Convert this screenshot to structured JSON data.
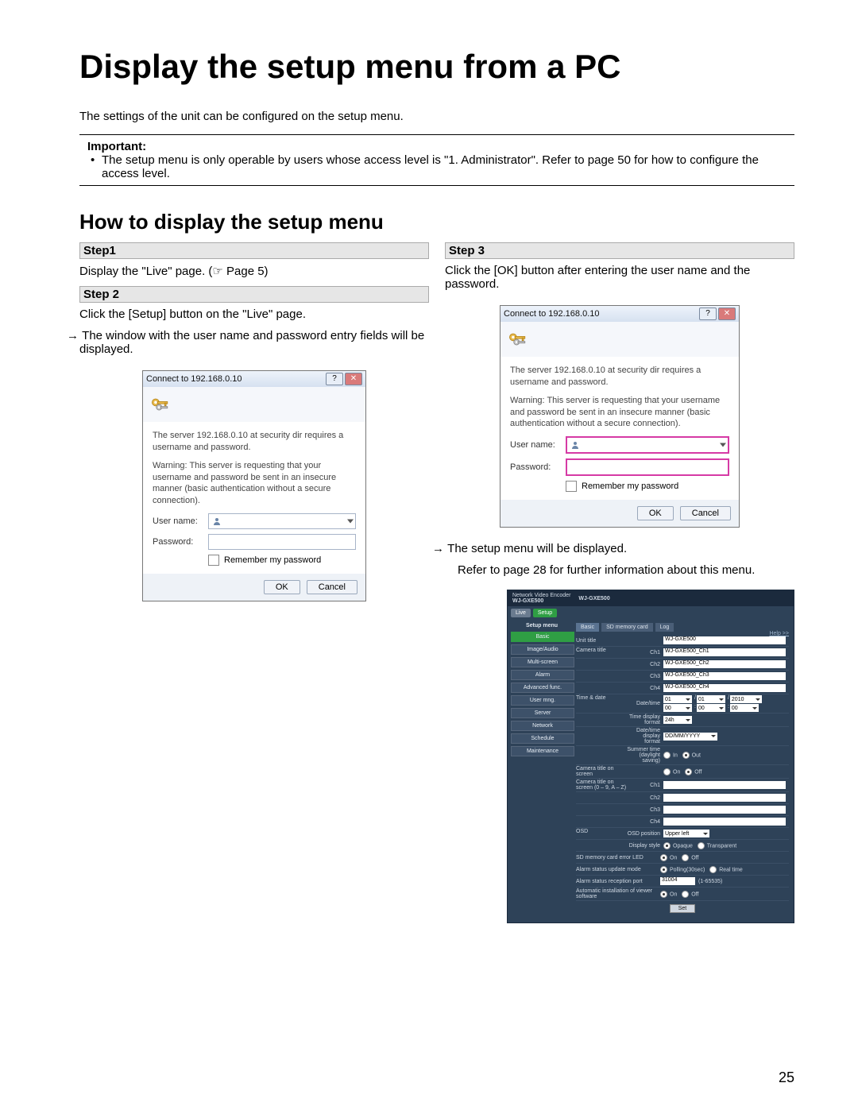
{
  "title": "Display the setup menu from a PC",
  "intro": "The settings of the unit can be configured on the setup menu.",
  "important_label": "Important:",
  "important_body": "The setup menu is only operable by users whose access level is \"1. Administrator\". Refer to page 50 for how to configure the access level.",
  "section_heading": "How to display the setup menu",
  "page_number": "25",
  "left": {
    "step1_label": "Step1",
    "step1_body": "Display the \"Live\" page. (☞ Page 5)",
    "step2_label": "Step 2",
    "step2_body": "Click the [Setup] button on the \"Live\" page.",
    "step2_arrow": "The window with the user name and password entry fields will be displayed."
  },
  "right": {
    "step3_label": "Step 3",
    "step3_body": "Click the [OK] button after entering the user name and the password.",
    "step3_arrow": "The setup menu will be displayed.",
    "step3_ref": "Refer to  page 28 for further information about this menu."
  },
  "dialog": {
    "title": "Connect to 192.168.0.10",
    "line1": "The server 192.168.0.10 at security dir requires a username and password.",
    "line2": "Warning: This server is requesting that your username and password be sent in an insecure manner (basic authentication without a secure connection).",
    "user_label": "User name:",
    "pass_label": "Password:",
    "remember": "Remember my password",
    "ok": "OK",
    "cancel": "Cancel"
  },
  "setup": {
    "product_line1": "Network Video Encoder",
    "product_line2": "WJ-GXE500",
    "model": "WJ-GXE500",
    "tab_live": "Live",
    "tab_setup": "Setup",
    "side_header": "Setup menu",
    "side": [
      "Basic",
      "Image/Audio",
      "Multi-screen",
      "Alarm",
      "Advanced func.",
      "User mng.",
      "Server",
      "Network",
      "Schedule",
      "Maintenance"
    ],
    "content_tabs": [
      "Basic",
      "SD memory card",
      "Log"
    ],
    "help": "Help >>",
    "rows": {
      "unit_title": "Unit title",
      "unit_title_val": "WJ-GXE500",
      "camera_title": "Camera title",
      "ch_labels": [
        "Ch1",
        "Ch2",
        "Ch3",
        "Ch4"
      ],
      "ch_vals": [
        "WJ-GXE500_Ch1",
        "WJ-GXE500_Ch2",
        "WJ-GXE500_Ch3",
        "WJ-GXE500_Ch4"
      ],
      "time_date": "Time & date",
      "date_time": "Date/time",
      "date_vals": [
        "01",
        "/",
        "01",
        "/",
        "2010",
        "00",
        ":",
        "00",
        ":",
        "00"
      ],
      "time_display_format": "Time display format",
      "time_display_format_val": "24h",
      "date_time_display_format": "Date/time display format",
      "date_time_display_format_val": "DD/MM/YYYY",
      "dst": "Summer time (daylight saving)",
      "in": "In",
      "out": "Out",
      "camera_title_on_screen": "Camera title on screen",
      "on": "On",
      "off": "Off",
      "camera_title_on_screen_chars": "Camera title on screen (0 – 9, A – Z)",
      "osd": "OSD",
      "osd_position": "OSD position",
      "osd_position_val": "Upper left",
      "display_style": "Display style",
      "opaque": "Opaque",
      "transparent": "Transparent",
      "sd_led": "SD memory card error LED",
      "alarm_update": "Alarm status update mode",
      "polling": "Polling(30sec)",
      "realtime": "Real time",
      "alarm_port": "Alarm status reception port",
      "alarm_port_val": "31004",
      "alarm_port_range": "(1-65535)",
      "auto_install": "Automatic installation of viewer software",
      "set": "Set"
    }
  }
}
